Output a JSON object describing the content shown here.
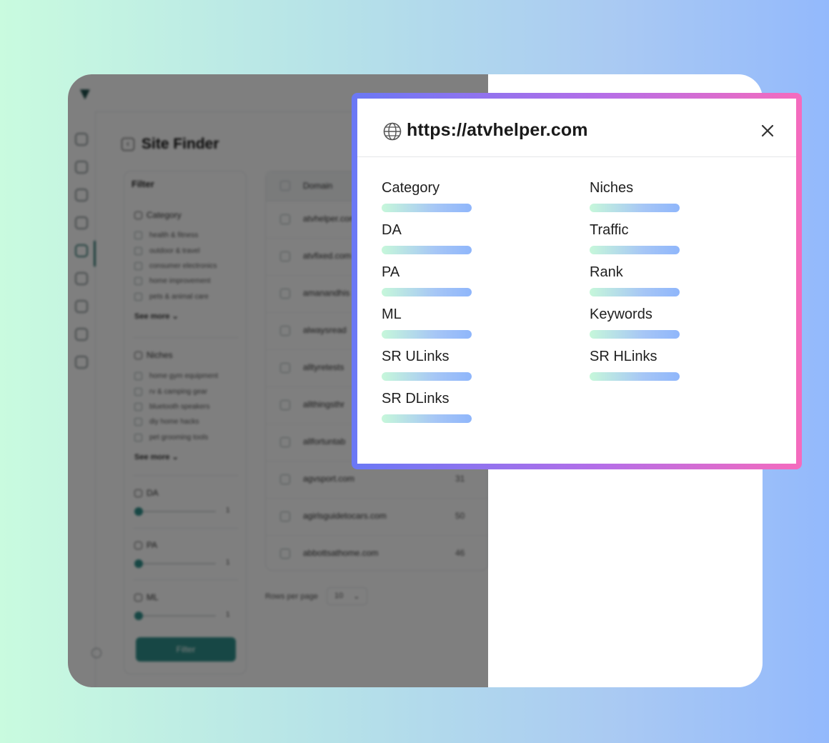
{
  "app": {
    "title": "Site Finder",
    "filter": {
      "title": "Filter",
      "category": {
        "label": "Category",
        "options": [
          "health & fitness",
          "outdoor & travel",
          "consumer electronics",
          "home improvement",
          "pets & animal care"
        ],
        "see_more": "See more"
      },
      "niches": {
        "label": "Niches",
        "options": [
          "home gym equipment",
          "rv & camping gear",
          "bluetooth speakers",
          "diy home hacks",
          "pet grooming tools"
        ],
        "see_more": "See more"
      },
      "sliders": [
        {
          "label": "DA",
          "value": "1"
        },
        {
          "label": "PA",
          "value": "1"
        },
        {
          "label": "ML",
          "value": "1"
        }
      ],
      "button": "Filter"
    },
    "table": {
      "header": "Domain",
      "rows": [
        {
          "domain": "atvhelper.com",
          "da": ""
        },
        {
          "domain": "atvfixed.com",
          "da": ""
        },
        {
          "domain": "amanandhis",
          "da": ""
        },
        {
          "domain": "alwaysread",
          "da": ""
        },
        {
          "domain": "alltyretests",
          "da": ""
        },
        {
          "domain": "allthingsthr",
          "da": ""
        },
        {
          "domain": "allfortuntab",
          "da": ""
        },
        {
          "domain": "agvsport.com",
          "da": "31"
        },
        {
          "domain": "agirlsguidetocars.com",
          "da": "50"
        },
        {
          "domain": "abbottsathome.com",
          "da": "46"
        }
      ],
      "rows_per_page_label": "Rows per page",
      "rows_per_page_value": "10"
    }
  },
  "modal": {
    "url": "https://atvhelper.com",
    "left_fields": [
      "Category",
      "DA",
      "PA",
      "ML",
      "SR ULinks",
      "SR DLinks"
    ],
    "right_fields": [
      "Niches",
      "Traffic",
      "Rank",
      "Keywords",
      "SR HLinks"
    ]
  }
}
